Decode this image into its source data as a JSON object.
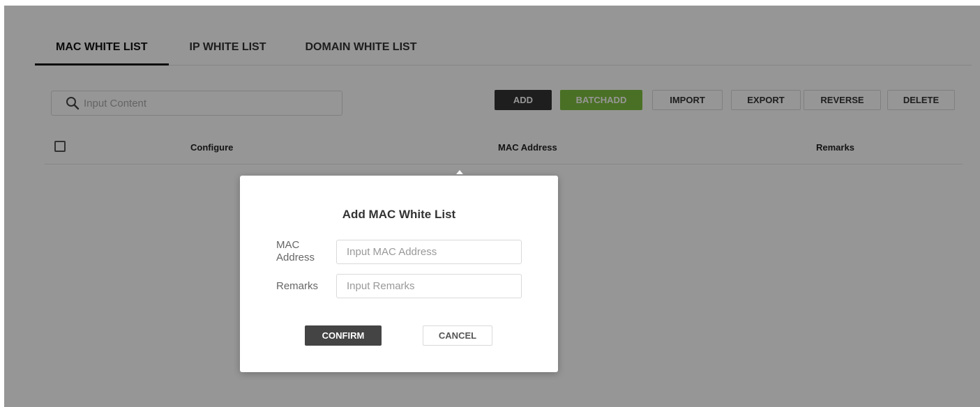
{
  "tabs": [
    {
      "label": "MAC WHITE LIST",
      "active": true
    },
    {
      "label": "IP WHITE LIST",
      "active": false
    },
    {
      "label": "DOMAIN WHITE LIST",
      "active": false
    }
  ],
  "search": {
    "placeholder": "Input Content",
    "icon": "search-icon"
  },
  "toolbar": {
    "add": "ADD",
    "batchadd": "BATCHADD",
    "import": "IMPORT",
    "export": "EXPORT",
    "reverse": "REVERSE",
    "delete": "DELETE"
  },
  "table": {
    "columns": [
      "Configure",
      "MAC Address",
      "Remarks"
    ]
  },
  "modal": {
    "title": "Add MAC White List",
    "mac_label": "MAC Address",
    "mac_placeholder": "Input MAC Address",
    "remarks_label": "Remarks",
    "remarks_placeholder": "Input Remarks",
    "confirm": "CONFIRM",
    "cancel": "CANCEL"
  },
  "colors": {
    "accent_dark": "#333333",
    "accent_green": "#7fbf3f",
    "overlay": "rgba(0,0,0,0.41)"
  }
}
